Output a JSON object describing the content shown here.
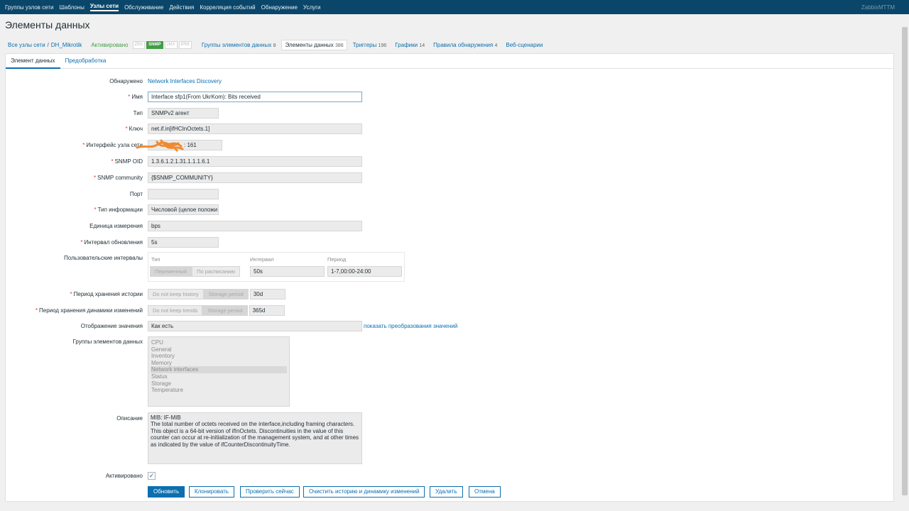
{
  "topnav": {
    "items": [
      "Группы узлов сети",
      "Шаблоны",
      "Узлы сети",
      "Обслуживание",
      "Действия",
      "Корреляция событий",
      "Обнаружение",
      "Услуги"
    ],
    "active_index": 2,
    "brand": "ZabbixMTTM"
  },
  "page_title": "Элементы данных",
  "hostnav": {
    "all_hosts": "Все узлы сети",
    "separator": "/",
    "host": "DH_Mikrotik",
    "status": "Активировано",
    "badges": [
      "ZBX",
      "SNMP",
      "JMX",
      "IPMI"
    ],
    "tabs": [
      {
        "label": "Группы элементов данных",
        "count": "8"
      },
      {
        "label": "Элементы данных",
        "count": "386"
      },
      {
        "label": "Триггеры",
        "count": "196"
      },
      {
        "label": "Графики",
        "count": "14"
      },
      {
        "label": "Правила обнаружения",
        "count": "4"
      },
      {
        "label": "Веб-сценарии",
        "count": ""
      }
    ]
  },
  "form_tabs": [
    "Элемент данных",
    "Предобработка"
  ],
  "form": {
    "discovered_label": "Обнаружено",
    "discovered_value": "Network Interfaces Discovery",
    "name_label": "Имя",
    "name_value": "Interface sfp1(From UkrKom): Bits received",
    "type_label": "Тип",
    "type_value": "SNMPv2 агент",
    "key_label": "Ключ",
    "key_value": "net.if.in[ifHCInOctets.1]",
    "interface_label": "Интерфейс узла сети",
    "interface_value": ": 161",
    "oid_label": "SNMP OID",
    "oid_value": "1.3.6.1.2.1.31.1.1.1.6.1",
    "community_label": "SNMP community",
    "community_value": "{$SNMP_COMMUNITY}",
    "port_label": "Порт",
    "port_value": "",
    "info_type_label": "Тип информации",
    "info_type_value": "Числовой (целое положи",
    "units_label": "Единица измерения",
    "units_value": "bps",
    "interval_label": "Интервал обновления",
    "interval_value": "5s",
    "custom_intervals_label": "Пользовательские интервалы",
    "ci_head_type": "Тип",
    "ci_head_interval": "Интервал",
    "ci_head_period": "Период",
    "ci_opt_flexible": "Переменный",
    "ci_opt_scheduling": "По расписанию",
    "ci_interval_value": "50s",
    "ci_period_value": "1-7,00:00-24:00",
    "history_label": "Период хранения истории",
    "history_opt1": "Do not keep history",
    "history_opt2": "Storage period",
    "history_value": "30d",
    "trends_label": "Период хранения динамики изменений",
    "trends_opt1": "Do not keep trends",
    "trends_opt2": "Storage period",
    "trends_value": "365d",
    "valuemap_label": "Отображение значения",
    "valuemap_value": "Как есть",
    "valuemap_link": "показать преобразования значений",
    "apps_label": "Группы элементов данных",
    "apps": [
      "CPU",
      "General",
      "Inventory",
      "Memory",
      "Network interfaces",
      "Status",
      "Storage",
      "Temperature"
    ],
    "apps_selected_index": 4,
    "description_label": "Описание",
    "description_lines": [
      "MIB: IF-MIB",
      "The total number of octets received on the interface,including framing characters.",
      "This object is a 64-bit version of ifInOctets. Discontinuities in the value of this",
      "counter can occur at re-initialization of the management system, and at other times",
      "as indicated by the value of ifCounterDiscontinuityTime."
    ],
    "enabled_label": "Активировано",
    "enabled": true
  },
  "buttons": {
    "update": "Обновить",
    "clone": "Клонировать",
    "check_now": "Проверить сейчас",
    "clear": "Очистить историю и динамику изменений",
    "delete": "Удалить",
    "cancel": "Отмена"
  },
  "colors": {
    "nav_bg": "#0a466a",
    "link": "#0b6fb0",
    "enabled": "#429e47",
    "required": "#e33734",
    "scribble": "#f08a30"
  }
}
